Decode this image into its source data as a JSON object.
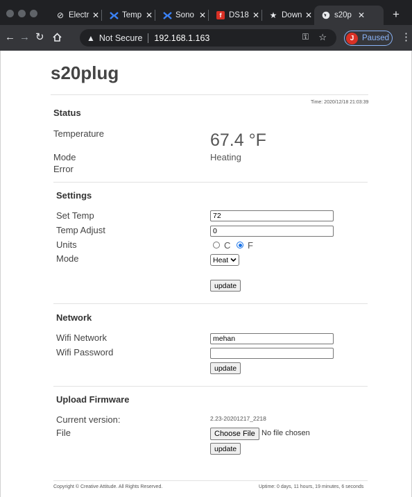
{
  "browser": {
    "tabs": [
      {
        "title": "Electr",
        "icon": "plug-icon"
      },
      {
        "title": "Temp",
        "icon": "x-brand-icon"
      },
      {
        "title": "Sono",
        "icon": "x-brand-icon"
      },
      {
        "title": "DS18",
        "icon": "flame-icon"
      },
      {
        "title": "Down",
        "icon": "star-icon"
      },
      {
        "title": "s20p",
        "icon": "globe-icon",
        "active": true
      }
    ],
    "security_label": "Not Secure",
    "url": "192.168.1.163",
    "profile_initial": "J",
    "profile_status": "Paused",
    "accent_color": "#8ab4f8"
  },
  "page": {
    "title": "s20plug",
    "time": "Time: 2020/12/18 21:03:39",
    "status": {
      "heading": "Status",
      "temperature_label": "Temperature",
      "temperature_value": "67.4 °F",
      "mode_label": "Mode",
      "mode_value": "Heating",
      "error_label": "Error"
    },
    "settings": {
      "heading": "Settings",
      "set_temp_label": "Set Temp",
      "set_temp_value": "72",
      "temp_adjust_label": "Temp Adjust",
      "temp_adjust_value": "0",
      "units_label": "Units",
      "unit_c": "C",
      "unit_f": "F",
      "selected_unit": "F",
      "mode_label": "Mode",
      "mode_value": "Heat",
      "update_label": "update"
    },
    "network": {
      "heading": "Network",
      "wifi_network_label": "Wifi Network",
      "wifi_network_value": "mehan",
      "wifi_password_label": "Wifi Password",
      "wifi_password_value": "",
      "update_label": "update"
    },
    "firmware": {
      "heading": "Upload Firmware",
      "current_version_label": "Current version:",
      "current_version_value": "2.23-20201217_2218",
      "file_label": "File",
      "choose_file_label": "Choose File",
      "no_file_text": "No file chosen",
      "update_label": "update"
    },
    "footer": {
      "copyright": "Copyright © Creative Attitude. All Rights Reserved.",
      "uptime": "Uptime: 0 days, 11 hours, 19 minutes, 6 seconds"
    }
  }
}
